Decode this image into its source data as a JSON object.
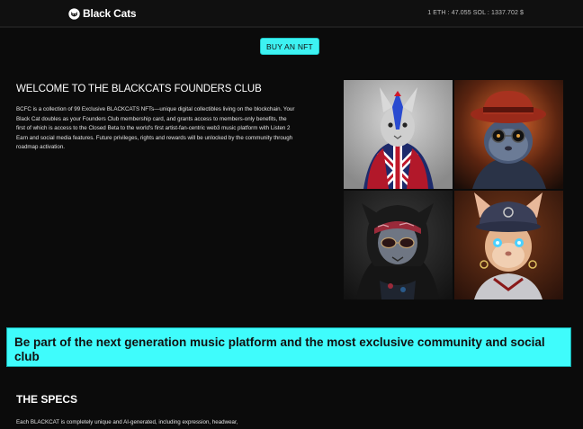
{
  "header": {
    "logo_text": "Black Cats",
    "logo_icon": "cat-paw-icon",
    "prices": "1 ETH :  47.055 SOL : 1337.702 $"
  },
  "hero": {
    "buy_label": "BUY AN NFT"
  },
  "welcome": {
    "title": "WELCOME TO THE BLACKCATS FOUNDERS CLUB",
    "description": "BCFC is a collection of 99 Exclusive BLACKCATS NFTs—unique digital collectibles living on the blockchain. Your Black Cat doubles as your Founders Club membership card, and grants access to members-only benefits, the first of which is access to the Closed Beta to the world's first artist-fan-centric web3 music platform with Listen 2 Earn and social media features. Future privileges, rights and rewards will be unlocked by the community through roadmap activation."
  },
  "gallery": {
    "items": [
      {
        "name": "union-jack-hoodie-cat"
      },
      {
        "name": "red-hat-blue-cat"
      },
      {
        "name": "bandana-sunglasses-cat"
      },
      {
        "name": "cap-glowing-eyes-cat"
      }
    ]
  },
  "banner": {
    "text": "Be part of the next generation music platform and the most exclusive community and social club"
  },
  "specs": {
    "title": "THE SPECS",
    "description": "Each BLACKCAT is completely unique and AI-generated, including expression, headwear,"
  },
  "colors": {
    "accent": "#3ffcfc",
    "background": "#0b0b0b"
  }
}
